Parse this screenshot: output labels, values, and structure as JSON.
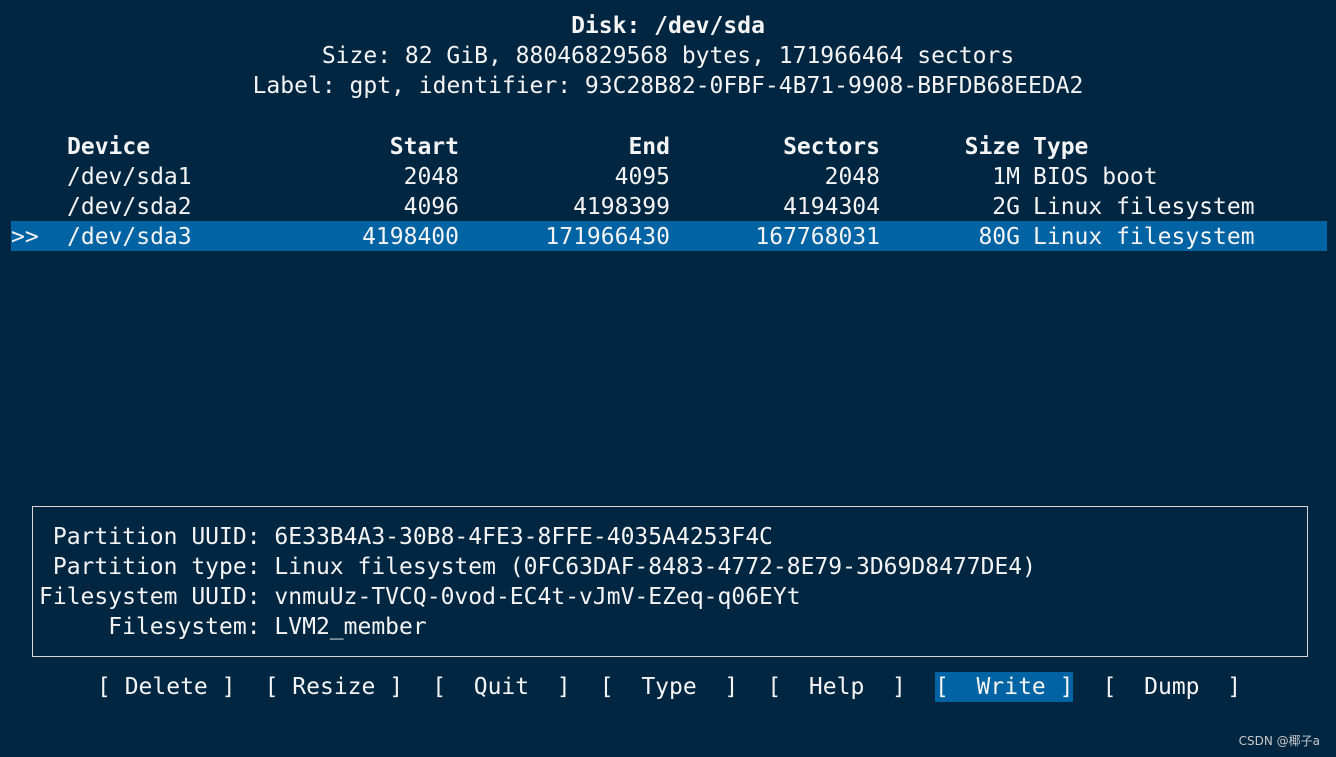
{
  "header": {
    "disk": "Disk: /dev/sda",
    "size": "Size: 82 GiB, 88046829568 bytes, 171966464 sectors",
    "label": "Label: gpt, identifier: 93C28B82-0FBF-4B71-9908-BBFDB68EEDA2"
  },
  "table": {
    "columns": [
      "Device",
      "Start",
      "End",
      "Sectors",
      "Size",
      "Type"
    ],
    "rows": [
      {
        "device": "/dev/sda1",
        "start": "2048",
        "end": "4095",
        "sectors": "2048",
        "size": "1M",
        "type": "BIOS boot"
      },
      {
        "device": "/dev/sda2",
        "start": "4096",
        "end": "4198399",
        "sectors": "4194304",
        "size": "2G",
        "type": "Linux filesystem"
      },
      {
        "device": "/dev/sda3",
        "start": "4198400",
        "end": "171966430",
        "sectors": "167768031",
        "size": "80G",
        "type": "Linux filesystem"
      }
    ],
    "selected_index": 2,
    "selection_marker": ">>"
  },
  "info": {
    "lines": [
      " Partition UUID: 6E33B4A3-30B8-4FE3-8FFE-4035A4253F4C",
      " Partition type: Linux filesystem (0FC63DAF-8483-4772-8E79-3D69D8477DE4)",
      "Filesystem UUID: vnmuUz-TVCQ-0vod-EC4t-vJmV-EZeq-q06EYt",
      "     Filesystem: LVM2_member"
    ]
  },
  "menu": {
    "buttons": [
      "[ Delete ]",
      "[ Resize ]",
      "[  Quit  ]",
      "[  Type  ]",
      "[  Help  ]",
      "[  Write ]",
      "[  Dump  ]"
    ],
    "selected_index": 5
  },
  "watermark": "CSDN @椰子a",
  "colors": {
    "background": "#012641",
    "highlight": "#0063a3",
    "text": "#f4f4f4"
  }
}
